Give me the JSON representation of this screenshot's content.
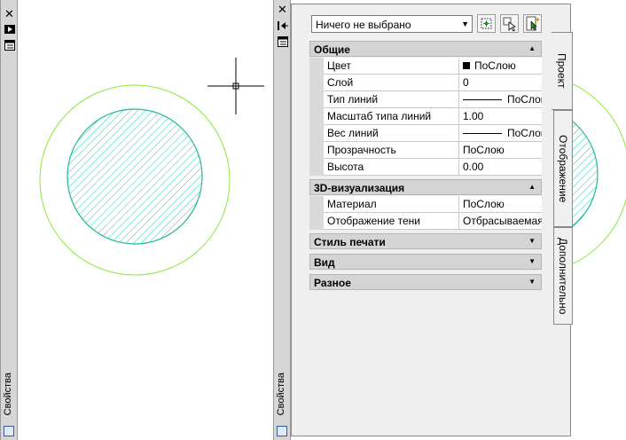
{
  "left_strip": {
    "title": "Свойства"
  },
  "panel_strip": {
    "title": "Свойства"
  },
  "selector": {
    "value": "Ничего не выбрано"
  },
  "sections": {
    "general": {
      "title": "Общие",
      "rows": [
        {
          "name": "Цвет",
          "value": "ПоСлою"
        },
        {
          "name": "Слой",
          "value": "0"
        },
        {
          "name": "Тип линий",
          "value": "ПоСлою"
        },
        {
          "name": "Масштаб типа линий",
          "value": "1.00"
        },
        {
          "name": "Вес линий",
          "value": "ПоСлою"
        },
        {
          "name": "Прозрачность",
          "value": "ПоСлою"
        },
        {
          "name": "Высота",
          "value": "0.00"
        }
      ]
    },
    "viz3d": {
      "title": "3D-визуализация",
      "rows": [
        {
          "name": "Материал",
          "value": "ПоСлою"
        },
        {
          "name": "Отображение тени",
          "value": "Отбрасываемая и..."
        }
      ]
    },
    "plotstyle": {
      "title": "Стиль печати"
    },
    "view": {
      "title": "Вид"
    },
    "misc": {
      "title": "Разное"
    }
  },
  "tabs": {
    "project": "Проект",
    "display": "Отображение",
    "extra": "Дополнительно"
  },
  "colors": {
    "hatch": "#26c6b4",
    "outer_circle": "#8ee83a",
    "panel_bg": "#efefef"
  },
  "icons": [
    "close-icon",
    "autohide-icon",
    "menu-icon",
    "quick-select-icon",
    "select-objects-icon",
    "pickadd-icon",
    "dropdown-arrow-icon"
  ]
}
